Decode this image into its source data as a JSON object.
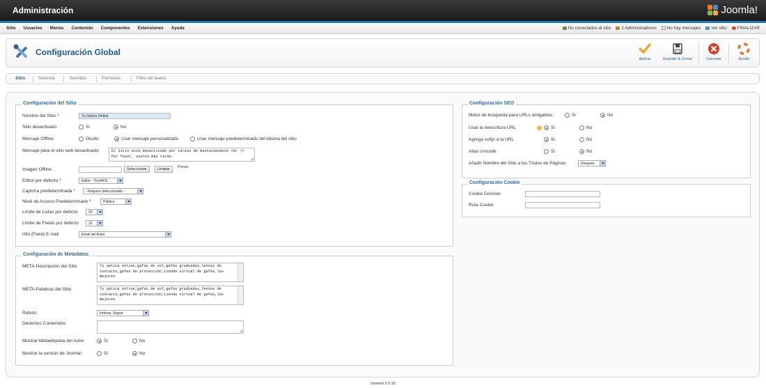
{
  "header": {
    "title": "Administración",
    "brand": "Joomla!"
  },
  "menu": [
    "Sitio",
    "Usuarios",
    "Menús",
    "Contenido",
    "Componentes",
    "Extensiones",
    "Ayuda"
  ],
  "status": {
    "visitors": "No conectados al sitio",
    "admins": "2 Administradores",
    "messages": "No hay mensajes",
    "view_site": "Ver sitio",
    "logout": "FINALIZAR"
  },
  "toolbar": {
    "page_title": "Configuración Global",
    "apply": "Aplicar",
    "save_close": "Guardar & Cerrar",
    "cancel": "Cancelar",
    "help": "Ayuda"
  },
  "tabs": [
    "Sitio",
    "Sistema",
    "Servidor",
    "Permisos",
    "Filtro de textos"
  ],
  "site": {
    "legend": "Configuración del Sitio",
    "name_label": "Nombre del Sitio",
    "name_value": "Tu Optica Online",
    "offline_label": "Sitio desactivado",
    "yes": "Si",
    "no": "No",
    "offline_msg_label": "Mensaje Offline",
    "opt_hidden": "Oculto",
    "opt_custom": "Usar mensaje personalizado",
    "opt_default": "Usar mensaje predeterminado del idioma del sitio",
    "offline_text_label": "Mensaje para el sitio web desactivado",
    "offline_text_value": "El sitio está desactivado por tareas de mantenimiento <br /> Por favor, vuelva más tarde.",
    "offline_image_label": "Imagen Offline",
    "select_btn": "Seleccionar",
    "clear_btn": "Limpiar",
    "preview": "Previo",
    "editor_label": "Editor por defecto",
    "editor_value": "Editor - TinyMCE",
    "captcha_label": "Captcha predeterminada",
    "captcha_value": "- Ninguno Seleccionado -",
    "access_label": "Nivel de Acceso Predeterminado",
    "access_value": "Público",
    "list_limit_label": "Límite de Listas por defecto",
    "list_limit_value": "20",
    "feed_limit_label": "Límite de Feeds por defecto",
    "feed_limit_value": "10",
    "feed_email_label": "Hilo (Feed) E-mail",
    "feed_email_value": "Email del Autor"
  },
  "metadata": {
    "legend": "Configuración de Metadatos",
    "desc_label": "META-Descripción del Sitio",
    "desc_value": "Tu optica online,gafas de sol,gafas graduadas,lentes de contacto,gafas de protección,tienda virtual de gafas,las mejores",
    "keys_label": "META-Palabras del Sitio",
    "keys_value": "Tu optica online,gafas de sol,gafas graduadas,lentes de contacto,gafas de protección,tienda virtual de gafas,las mejores",
    "robots_label": "Robots",
    "robots_value": "Indexar, Seguir",
    "rights_label": "Derechos Contenidos",
    "author_label": "Mostrar Metaetiqueta del Autor",
    "version_label": "Mostrar la versión de Joomla!"
  },
  "seo": {
    "legend": "Configuración SEO",
    "sef_label": "Motor de búsqueda para URLs amigables",
    "rewrite_label": "Usar la reescritura URL",
    "suffix_label": "Agrega sufijo a la URL",
    "unicode_label": "Alias Unicode",
    "sitename_label": "Añadir Nombre del Sitio a los Títulos de Páginas",
    "sitename_value": "Después"
  },
  "cookie": {
    "legend": "Configuración Cookie",
    "domain_label": "Cookie Dominio",
    "path_label": "Ruta Cookie"
  },
  "footer": "Joomla! 2.5.16",
  "colors": {
    "accent": "#1e7bbf",
    "legend": "#2f6a9e",
    "apply": "#f0a020",
    "cancel": "#d9401f"
  }
}
